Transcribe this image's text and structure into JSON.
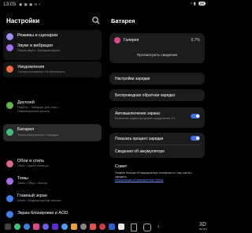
{
  "status_bar": {
    "time": "13:05",
    "battery": "80"
  },
  "left": {
    "title": "Настройки",
    "items": [
      {
        "label": "Режимы и сценарии",
        "color": "#9b8cf0"
      },
      {
        "label": "Звуки и вибрация",
        "sub": "Режим звука • Мелодия звонка",
        "color": "#a56cf0"
      },
      {
        "label": "Уведомления",
        "sub": "Строка состояния • Не беспокоить",
        "color": "#f26b3a"
      },
      {
        "label": "Дисплей",
        "sub": "Яркость • Комфорт для глаз •",
        "sub2": "Навигационная панель",
        "color": "#5fb64a"
      },
      {
        "label": "Батарея",
        "sub": "Энергосбережение • Зарядка",
        "color": "#3cc07a"
      },
      {
        "label": "Обои и стиль",
        "sub": "Обои • Цвета палитры",
        "color": "#e0648a"
      },
      {
        "label": "Темы",
        "sub": "Темы • Обои • Значки",
        "color": "#a46fe8"
      },
      {
        "label": "Главный экран",
        "sub": "Макет • Индикаторы на значках",
        "color": "#3e7ef0"
      },
      {
        "label": "Экран блокировки и AOD",
        "color": "#3e7ef0"
      }
    ]
  },
  "right": {
    "title": "Батарея",
    "gallery": {
      "label": "Галерея",
      "percent": "0,7%",
      "button": "Просмотреть сведения"
    },
    "charging_settings": "Настройки зарядки",
    "wireless_reverse": "Беспроводная обратная зарядка",
    "auto_lock": {
      "label": "Автовыключение экрана",
      "sub": "Включение экрана при уровне заряда менее 5%."
    },
    "show_percent": "Показать процент зарядки",
    "about_battery": "Сведения об аккумуляторе",
    "advice": {
      "title": "Совет",
      "text": "Узнайте больше об аккумуляторе телефона и о том, как его зарядить.",
      "link": "Информация об аккумуляторе Galaxy"
    }
  },
  "watermark": {
    "brand": "3D",
    "sub": "NEWS"
  }
}
